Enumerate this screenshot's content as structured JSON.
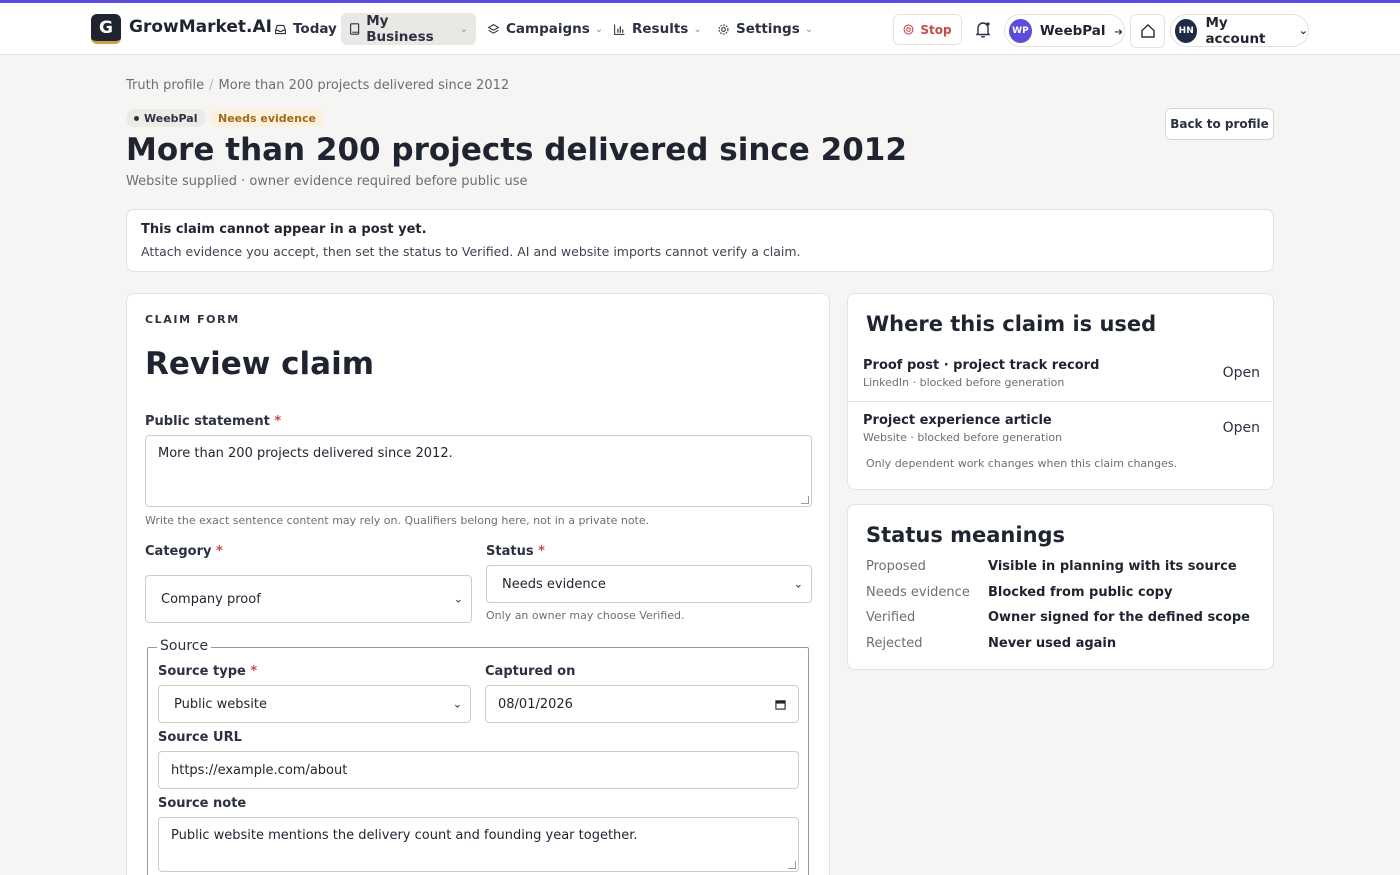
{
  "brand": {
    "logo_letter": "G",
    "name": "GrowMarket.AI",
    "accent": "#5b4ddb"
  },
  "nav": [
    {
      "label": "Today",
      "icon": "inbox-icon"
    },
    {
      "label": "My Business",
      "icon": "book-icon",
      "active": true
    },
    {
      "label": "Campaigns",
      "icon": "layers-icon"
    },
    {
      "label": "Results",
      "icon": "bar-chart-icon"
    },
    {
      "label": "Settings",
      "icon": "gear-icon"
    }
  ],
  "header": {
    "stop_label": "Stop",
    "business": {
      "initials": "WP",
      "name": "WeebPal"
    },
    "account": {
      "initials": "HN",
      "label": "My account"
    }
  },
  "breadcrumb": {
    "root": "Truth profile",
    "current": "More than 200 projects delivered since 2012"
  },
  "badges": {
    "business": "WeebPal",
    "status": "Needs evidence"
  },
  "page": {
    "title": "More than 200 projects delivered since 2012",
    "subtitle": "Website supplied · owner evidence required before public use",
    "back_label": "Back to profile"
  },
  "alert": {
    "title": "This claim cannot appear in a post yet.",
    "body": "Attach evidence you accept, then set the status to Verified. AI and website imports cannot verify a claim."
  },
  "form": {
    "eyebrow": "CLAIM FORM",
    "title": "Review claim",
    "statement": {
      "label": "Public statement",
      "value": "More than 200 projects delivered since 2012.",
      "help": "Write the exact sentence content may rely on. Qualifiers belong here, not in a private note."
    },
    "category": {
      "label": "Category",
      "value": "Company proof"
    },
    "status": {
      "label": "Status",
      "value": "Needs evidence",
      "help": "Only an owner may choose Verified."
    },
    "source": {
      "legend": "Source",
      "type": {
        "label": "Source type",
        "value": "Public website"
      },
      "captured": {
        "label": "Captured on",
        "value": "08/01/2026"
      },
      "url": {
        "label": "Source URL",
        "value": "https://example.com/about"
      },
      "note": {
        "label": "Source note",
        "value": "Public website mentions the delivery count and founding year together."
      }
    }
  },
  "usage": {
    "title": "Where this claim is used",
    "items": [
      {
        "name": "Proof post · project track record",
        "meta": "LinkedIn · blocked before generation",
        "action": "Open"
      },
      {
        "name": "Project experience article",
        "meta": "Website · blocked before generation",
        "action": "Open"
      }
    ],
    "note": "Only dependent work changes when this claim changes."
  },
  "status_meanings": {
    "title": "Status meanings",
    "rows": [
      {
        "term": "Proposed",
        "meaning": "Visible in planning with its source"
      },
      {
        "term": "Needs evidence",
        "meaning": "Blocked from public copy"
      },
      {
        "term": "Verified",
        "meaning": "Owner signed for the defined scope"
      },
      {
        "term": "Rejected",
        "meaning": "Never used again"
      }
    ]
  }
}
